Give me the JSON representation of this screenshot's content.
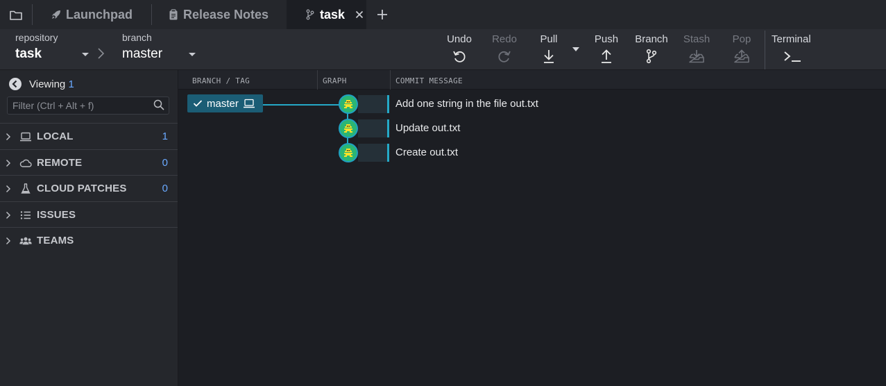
{
  "tabs": {
    "items": [
      {
        "label": "Launchpad",
        "icon": "rocket-icon"
      },
      {
        "label": "Release Notes",
        "icon": "clipboard-icon"
      },
      {
        "label": "task",
        "icon": "branch-icon",
        "active": true
      }
    ]
  },
  "repo": {
    "repository_label": "repository",
    "repository_name": "task",
    "branch_label": "branch",
    "branch_name": "master"
  },
  "toolbar": {
    "undo": "Undo",
    "redo": "Redo",
    "pull": "Pull",
    "push": "Push",
    "branch": "Branch",
    "stash": "Stash",
    "pop": "Pop",
    "terminal": "Terminal"
  },
  "sidebar": {
    "viewing_label": "Viewing",
    "viewing_count": "1",
    "filter_placeholder": "Filter (Ctrl + Alt + f)",
    "sections": [
      {
        "label": "LOCAL",
        "icon": "laptop-icon",
        "count": "1"
      },
      {
        "label": "REMOTE",
        "icon": "cloud-icon",
        "count": "0"
      },
      {
        "label": "CLOUD PATCHES",
        "icon": "flask-icon",
        "count": "0"
      },
      {
        "label": "ISSUES",
        "icon": "list-icon",
        "count": ""
      },
      {
        "label": "TEAMS",
        "icon": "users-icon",
        "count": ""
      }
    ]
  },
  "graph": {
    "columns": {
      "branch_tag": "BRANCH / TAG",
      "graph": "GRAPH",
      "commit_message": "COMMIT MESSAGE"
    },
    "branch_pill": "master",
    "commits": [
      {
        "message": "Add one string in the file out.txt"
      },
      {
        "message": "Update out.txt"
      },
      {
        "message": "Create out.txt"
      }
    ]
  },
  "colors": {
    "accent": "#25a9c7",
    "pill": "#1b5d75",
    "count": "#6aa9ff",
    "node": "#2bb673"
  }
}
